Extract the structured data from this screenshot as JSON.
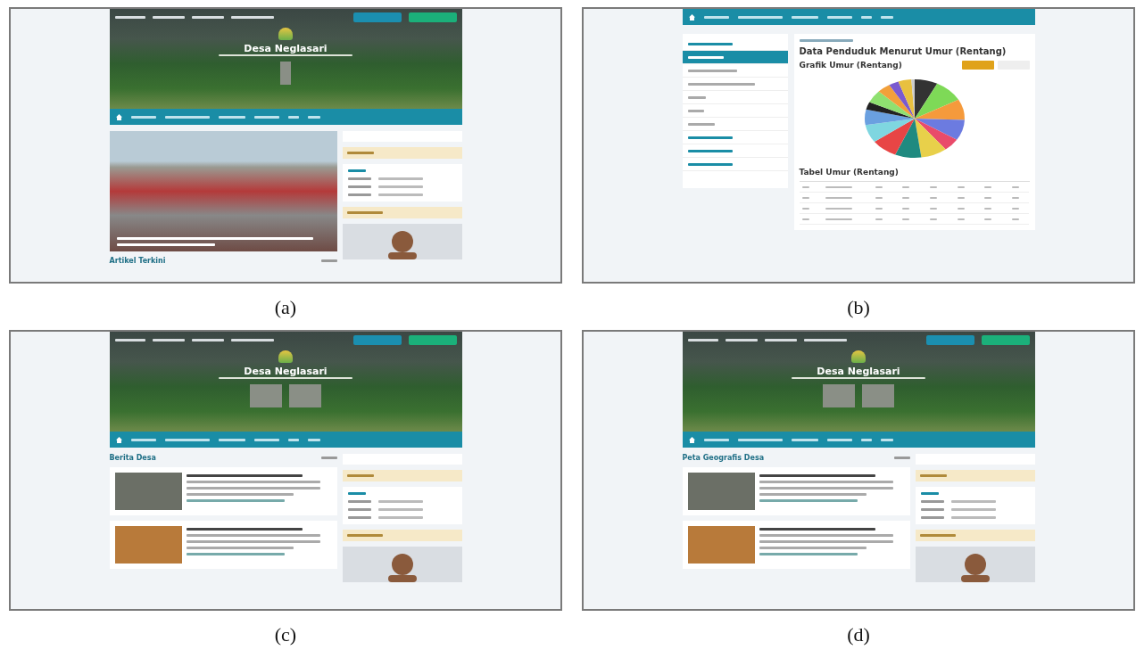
{
  "figures": [
    {
      "kind": "home",
      "caption": "(a)",
      "site_title": "Desa Neglasari",
      "main": [
        {
          "kind": "photo"
        },
        {
          "kind": "heading",
          "text": "Artikel Terkini"
        }
      ]
    },
    {
      "kind": "stats",
      "caption": "(b)",
      "page_title": "Data Penduduk Menurut Umur (Rentang)",
      "chart_title": "Grafik Umur (Rentang)",
      "table_title": "Tabel Umur (Rentang)",
      "menu_items": [
        {
          "selected": false
        },
        {
          "selected": true
        },
        {
          "selected": false
        },
        {
          "selected": false
        },
        {
          "selected": false
        },
        {
          "selected": false
        },
        {
          "selected": false
        },
        {
          "selected": false
        },
        {
          "selected": false
        },
        {
          "selected": false
        }
      ]
    },
    {
      "kind": "home",
      "caption": "(c)",
      "site_title": "Desa Neglasari",
      "main": [
        {
          "kind": "heading",
          "text": "Berita Desa"
        },
        {
          "kind": "card"
        },
        {
          "kind": "card"
        }
      ]
    },
    {
      "kind": "home",
      "caption": "(d)",
      "site_title": "Desa Neglasari",
      "main": [
        {
          "kind": "heading",
          "text": "Peta Geografis Desa"
        },
        {
          "kind": "card"
        },
        {
          "kind": "card"
        }
      ]
    }
  ]
}
